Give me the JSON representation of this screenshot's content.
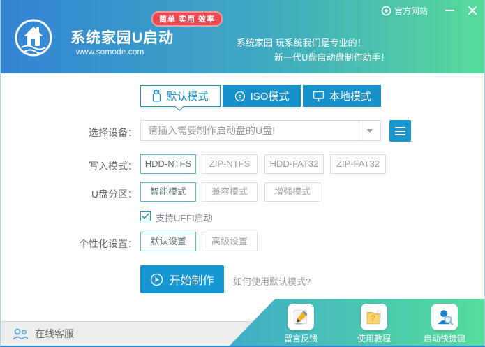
{
  "header": {
    "badge": "简单 实用 效率",
    "title": "系统家园U启动",
    "website": "www.somode.com",
    "slogan1": "系统家园 玩系统我们是专业的！",
    "slogan2": "新一代U盘启动盘制作助手！",
    "official_site": "官方网站"
  },
  "tabs": [
    {
      "label": "默认模式",
      "active": true
    },
    {
      "label": "ISO模式",
      "active": false
    },
    {
      "label": "本地模式",
      "active": false
    }
  ],
  "form": {
    "device": {
      "label": "选择设备：",
      "value": "请插入需要制作启动盘的U盘!"
    },
    "write_mode": {
      "label": "写入模式：",
      "options": [
        "HDD-NTFS",
        "ZIP-NTFS",
        "HDD-FAT32",
        "ZIP-FAT32"
      ],
      "selected": "HDD-NTFS"
    },
    "partition": {
      "label": "U盘分区：",
      "options": [
        "智能模式",
        "兼容模式",
        "增强模式"
      ],
      "selected": "智能模式"
    },
    "uefi": {
      "label": "支持UEFI启动",
      "checked": true
    },
    "personalize": {
      "label": "个性化设置：",
      "options": [
        "默认设置",
        "高级设置"
      ],
      "selected": "默认设置"
    },
    "start_label": "开始制作",
    "help_link": "如何使用默认模式?"
  },
  "footer": {
    "service_label": "在线客服",
    "quick_links": [
      {
        "label": "留言反馈"
      },
      {
        "label": "使用教程"
      },
      {
        "label": "启动快捷键"
      }
    ]
  },
  "colors": {
    "header_gradient_start": "#3384d5",
    "header_gradient_end": "#57db9b",
    "badge_red": "#e9494f",
    "tab_blue": "#1791c9",
    "accent_blue": "#1b8fc9",
    "start_button_blue": "#1697d3",
    "active_border_blue": "#55b7d9",
    "ribbon_gradient_start": "#3fadc8",
    "ribbon_gradient_end": "#55dd9b",
    "folder_yellow": "#f6d86a"
  }
}
